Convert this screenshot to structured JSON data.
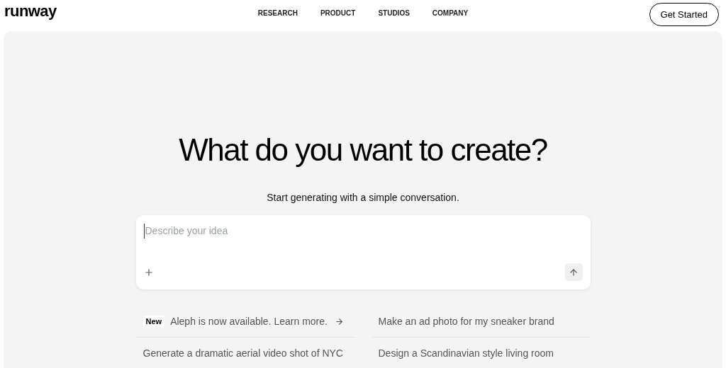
{
  "logo": "runway",
  "nav": [
    "RESEARCH",
    "PRODUCT",
    "STUDIOS",
    "COMPANY"
  ],
  "cta": "Get Started",
  "hero": {
    "title": "What do you want to create?",
    "subtitle": "Start generating with a simple conversation."
  },
  "prompt": {
    "placeholder": "Describe your idea"
  },
  "suggestions": [
    {
      "kind": "announcement",
      "badge": "New",
      "text": "Aleph is now available. Learn more."
    },
    {
      "kind": "prompt",
      "text": "Make an ad photo for my sneaker brand"
    },
    {
      "kind": "prompt",
      "text": "Generate a dramatic aerial video shot of NYC"
    },
    {
      "kind": "prompt",
      "text": "Design a Scandinavian style living room"
    }
  ]
}
